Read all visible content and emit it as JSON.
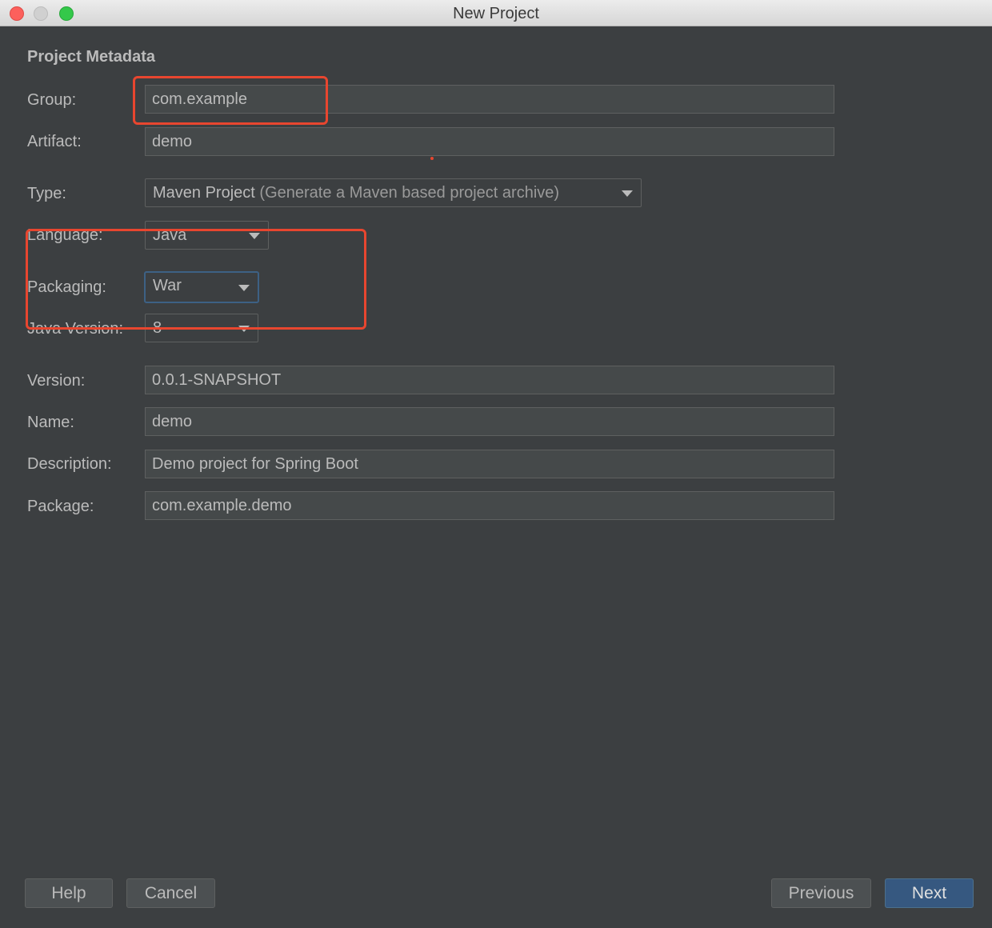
{
  "window": {
    "title": "New Project"
  },
  "form": {
    "section_title": "Project Metadata",
    "group": {
      "label": "Group:",
      "value": "com.example"
    },
    "artifact": {
      "label": "Artifact:",
      "value": "demo"
    },
    "type": {
      "label": "Type:",
      "value": "Maven Project",
      "hint": "(Generate a Maven based project archive)"
    },
    "language": {
      "label": "Language:",
      "value": "Java"
    },
    "packaging": {
      "label": "Packaging:",
      "value": "War"
    },
    "java_version": {
      "label": "Java Version:",
      "value": "8"
    },
    "version": {
      "label": "Version:",
      "value": "0.0.1-SNAPSHOT"
    },
    "name": {
      "label": "Name:",
      "value": "demo"
    },
    "description": {
      "label": "Description:",
      "value": "Demo project for Spring Boot"
    },
    "package": {
      "label": "Package:",
      "value": "com.example.demo"
    }
  },
  "buttons": {
    "help": "Help",
    "cancel": "Cancel",
    "previous": "Previous",
    "next": "Next"
  },
  "colors": {
    "background": "#3c3f41",
    "annotation": "#e8462f",
    "focus": "#3d6185",
    "primary_button": "#365880"
  }
}
